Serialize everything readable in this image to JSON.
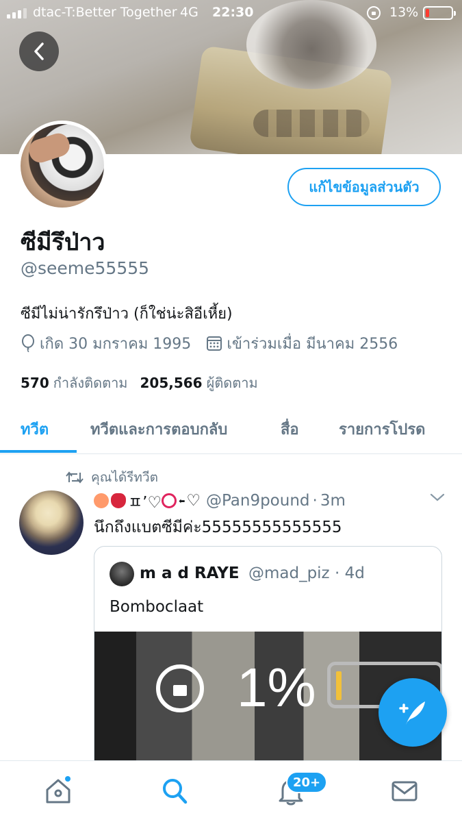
{
  "status_bar": {
    "carrier": "dtac-T:Better Together",
    "network": "4G",
    "time": "22:30",
    "battery_percent": "13%",
    "battery_level": 0.13,
    "battery_color": "#ff3b30"
  },
  "header": {
    "back_icon": "chevron-left-icon"
  },
  "profile": {
    "edit_button": "แก้ไขข้อมูลส่วนตัว",
    "display_name": "ซีมีรึป่าว",
    "handle": "@seeme55555",
    "bio": "ซีมีไม่น่ารักรึป่าว (ก็ใช่น่ะสิอีเหี้ย)",
    "birthday": "เกิด 30 มกราคม 1995",
    "joined": "เข้าร่วมเมื่อ มีนาคม 2556",
    "following_count": "570",
    "following_label": "กำลังติดตาม",
    "followers_count": "205,566",
    "followers_label": "ผู้ติดตาม"
  },
  "tabs": [
    {
      "label": "ทวีต",
      "active": true
    },
    {
      "label": "ทวีตและการตอบกลับ",
      "active": false
    },
    {
      "label": "สื่อ",
      "active": false
    },
    {
      "label": "รายการโปรด",
      "active": false
    }
  ],
  "tweet": {
    "retweet_label": "คุณได้รีทวีต",
    "author_suffix": "ㅍ’♡",
    "author_end": "♡",
    "handle": "@Pan9pound",
    "time": "3m",
    "text": "นึกถึงแบตซีมีค่ะ55555555555555",
    "quote": {
      "author": "m a d RAYE",
      "handle": "@mad_piz",
      "time": "4d",
      "text": "Bomboclaat",
      "media_text": "1%"
    }
  },
  "bottom_nav": {
    "notifications_badge": "20+"
  },
  "colors": {
    "accent": "#1da1f2",
    "muted": "#657786"
  }
}
